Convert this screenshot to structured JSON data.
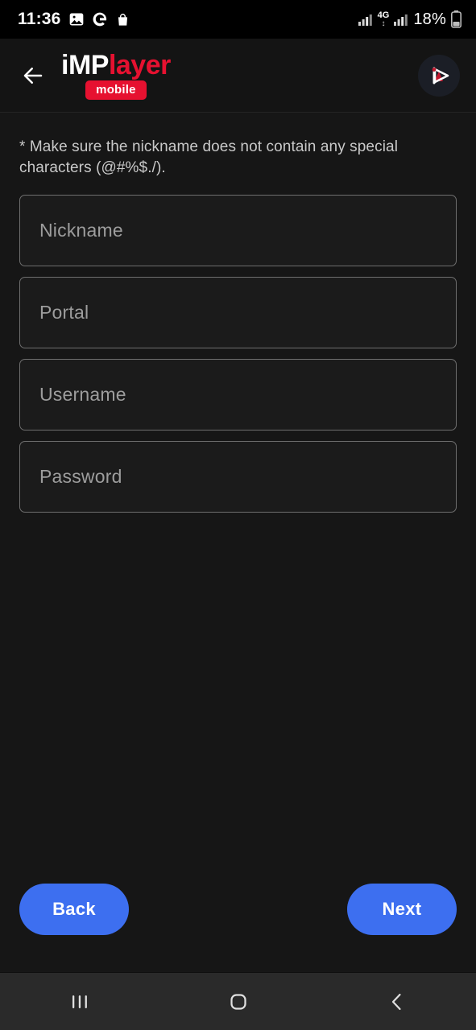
{
  "status_bar": {
    "time": "11:36",
    "battery_percent": "18%",
    "network_type": "4G",
    "icons": [
      "photos-icon",
      "google-icon",
      "shopping-bag-icon",
      "signal-bars-icon",
      "mobile-data-icon",
      "signal-bars-2-icon",
      "battery-icon"
    ]
  },
  "app_bar": {
    "back_icon": "arrow-left-icon",
    "logo": {
      "part1": "iMP",
      "part2": "layer",
      "badge": "mobile"
    },
    "avatar_icon": "implayer-mark-icon"
  },
  "main": {
    "hint": "* Make sure the nickname does not contain any special characters (@#%$./).",
    "fields": [
      {
        "name": "nickname",
        "placeholder": "Nickname",
        "value": ""
      },
      {
        "name": "portal",
        "placeholder": "Portal",
        "value": ""
      },
      {
        "name": "username",
        "placeholder": "Username",
        "value": ""
      },
      {
        "name": "password",
        "placeholder": "Password",
        "value": ""
      }
    ]
  },
  "footer": {
    "back_label": "Back",
    "next_label": "Next"
  },
  "nav_bar": {
    "recents": "recents-icon",
    "home": "home-icon",
    "back": "back-icon"
  },
  "colors": {
    "accent_blue": "#3d6ff0",
    "brand_red": "#e61130",
    "page_bg": "#161616",
    "field_border": "#6e6e6e"
  }
}
